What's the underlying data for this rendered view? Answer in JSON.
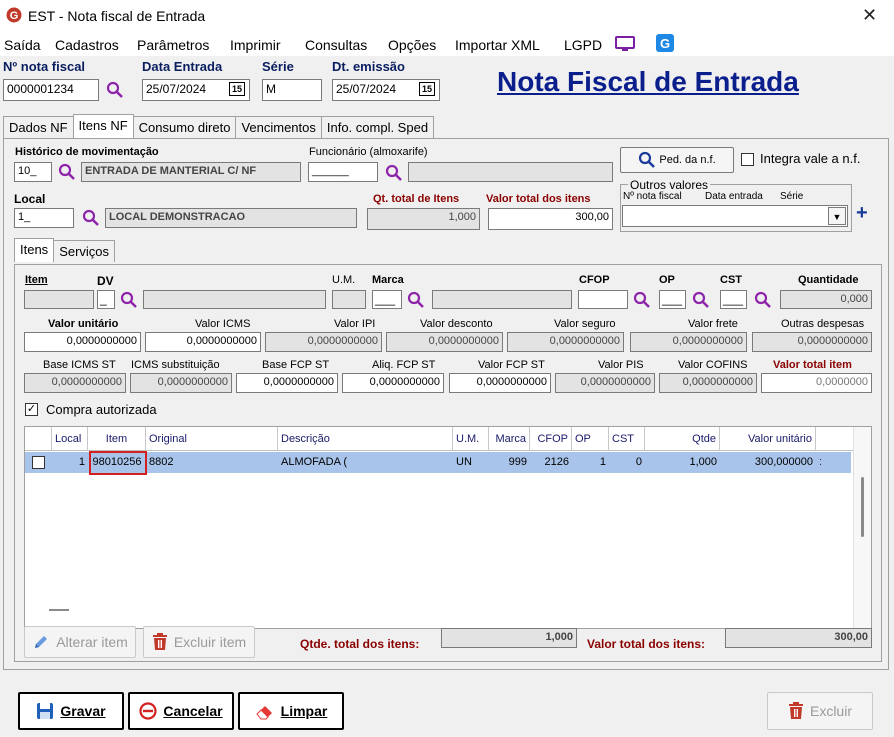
{
  "window": {
    "title": "EST - Nota fiscal de Entrada"
  },
  "menu": [
    "Saída",
    "Cadastros",
    "Parâmetros",
    "Imprimir",
    "Consultas",
    "Opções",
    "Importar XML",
    "LGPD"
  ],
  "header": {
    "nota_label": "Nº nota fiscal",
    "nota_value": "0000001234",
    "data_entrada_label": "Data Entrada",
    "data_entrada_value": "25/07/2024",
    "serie_label": "Série",
    "serie_value": "M",
    "dt_emissao_label": "Dt. emissão",
    "dt_emissao_value": "25/07/2024",
    "calendar_glyph": "15",
    "big_title": "Nota Fiscal de Entrada"
  },
  "main_tabs": [
    "Dados NF",
    "Itens NF",
    "Consumo direto",
    "Vencimentos",
    "Info. compl. Sped"
  ],
  "movimentacao": {
    "historico_label": "Histórico de movimentação",
    "historico_code": "10_",
    "historico_desc": "ENTRADA DE MANTERIAL C/ NF",
    "funcionario_label": "Funcionário (almoxarife)",
    "funcionario_code": "______",
    "funcionario_desc": "",
    "ped_button": "Ped. da n.f.",
    "integra_label": "Integra vale a n.f.",
    "local_label": "Local",
    "local_code": "1_",
    "local_desc": "LOCAL DEMONSTRACAO",
    "qt_total_label": "Qt. total de Itens",
    "qt_total_value": "1,000",
    "valor_total_label": "Valor total dos itens",
    "valor_total_value": "300,00",
    "outros_valores_label": "Outros valores",
    "outros_cols": [
      "Nº nota fiscal",
      "Data entrada",
      "Série"
    ]
  },
  "sub_tabs": [
    "Itens",
    "Serviços"
  ],
  "item_form": {
    "item_label": "Item",
    "dv_label": "DV",
    "dv_value": "_",
    "um_label": "U.M.",
    "marca_label": "Marca",
    "marca_value": "___",
    "cfop_label": "CFOP",
    "op_label": "OP",
    "op_value": "___",
    "cst_label": "CST",
    "cst_value": "___",
    "quantidade_label": "Quantidade",
    "quantidade_value": "0,000",
    "row2": [
      {
        "label": "Valor unitário",
        "value": "0,0000000000"
      },
      {
        "label": "Valor ICMS",
        "value": "0,0000000000"
      },
      {
        "label": "Valor IPI",
        "value": "0,0000000000"
      },
      {
        "label": "Valor desconto",
        "value": "0,0000000000"
      },
      {
        "label": "Valor seguro",
        "value": "0,0000000000"
      },
      {
        "label": "Valor frete",
        "value": "0,0000000000"
      },
      {
        "label": "Outras despesas",
        "value": "0,0000000000"
      }
    ],
    "row3": [
      {
        "label": "Base ICMS ST",
        "value": "0,0000000000"
      },
      {
        "label": "ICMS substituição",
        "value": "0,0000000000"
      },
      {
        "label": "Base FCP ST",
        "value": "0,0000000000"
      },
      {
        "label": "Aliq. FCP ST",
        "value": "0,0000000000"
      },
      {
        "label": "Valor FCP ST",
        "value": "0,0000000000"
      },
      {
        "label": "Valor PIS",
        "value": "0,0000000000"
      },
      {
        "label": "Valor COFINS",
        "value": "0,0000000000"
      },
      {
        "label": "Valor total item",
        "value": "0,0000000"
      }
    ],
    "compra_autorizada": "Compra autorizada",
    "check_glyph": "✓"
  },
  "grid": {
    "headers": [
      "Local",
      "Item",
      "Original",
      "Descrição",
      "U.M.",
      "Marca",
      "CFOP",
      "OP",
      "CST",
      "Qtde",
      "Valor unitário"
    ],
    "rows": [
      {
        "local": "1",
        "item": "98010256",
        "original": "8802",
        "descricao": "ALMOFADA (",
        "um": "UN",
        "marca": "999",
        "cfop": "2126",
        "op": "1",
        "cst": "0",
        "qtde": "1,000",
        "valor_unitario": "300,000000"
      }
    ]
  },
  "footer": {
    "alterar": "Alterar item",
    "excluir_item": "Excluir item",
    "qtde_total_label": "Qtde. total dos itens:",
    "qtde_total_value": "1,000",
    "valor_total_label": "Valor total dos itens:",
    "valor_total_value": "300,00"
  },
  "actions": {
    "gravar": "Gravar",
    "cancelar": "Cancelar",
    "limpar": "Limpar",
    "excluir": "Excluir"
  },
  "colors": {
    "accent": "#0a1e8c",
    "highlight_box": "#d32020",
    "row_selected": "#a9c4ea",
    "danger": "#c0392b"
  }
}
